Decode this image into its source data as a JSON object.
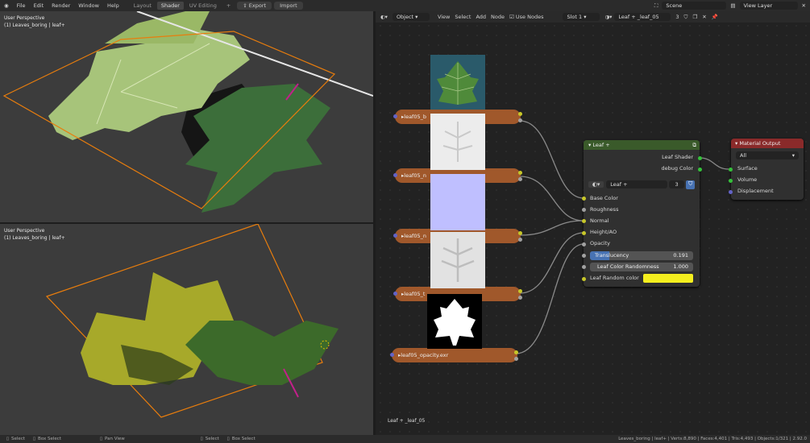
{
  "topbar": {
    "menus": [
      "File",
      "Edit",
      "Render",
      "Window",
      "Help"
    ],
    "workspaces": [
      "Layout",
      "Shader",
      "UV Editing"
    ],
    "active_workspace": "Shader",
    "export_label": "Export",
    "import_label": "Import",
    "scene": "Scene",
    "view_layer": "View Layer"
  },
  "viewport_top": {
    "perspective": "User Perspective",
    "object": "(1) Leaves_boring | leaf+"
  },
  "viewport_bottom": {
    "perspective": "User Perspective",
    "object": "(1) Leaves_boring | leaf+"
  },
  "node_header": {
    "mode": "Object",
    "menus": [
      "View",
      "Select",
      "Add",
      "Node"
    ],
    "use_nodes": "Use Nodes",
    "slot": "Slot 1",
    "material": "Leaf + _leaf_05",
    "users": "3"
  },
  "texture_nodes": [
    {
      "label": "leaf05_b"
    },
    {
      "label": "leaf05_n"
    },
    {
      "label": "leaf05_n"
    },
    {
      "label": "leaf05_t"
    },
    {
      "label": "leaf05_opacity.exr"
    }
  ],
  "leaf_node": {
    "title": "Leaf +",
    "outputs": [
      "Leaf Shader",
      "debug Color"
    ],
    "group_name": "Leaf +",
    "group_users": "3",
    "inputs": [
      "Base Color",
      "Roughness",
      "Normal",
      "Height/AO",
      "Opacity"
    ],
    "translucency_label": "Translucency",
    "translucency_value": "0.191",
    "translucency": 0.191,
    "randomness_label": "Leaf Color Randomness",
    "randomness_value": "1.000",
    "random_color_label": "Leaf Random color",
    "random_color": "#f5ef1e"
  },
  "output_node": {
    "title": "Material Output",
    "target": "All",
    "inputs": [
      "Surface",
      "Volume",
      "Displacement"
    ]
  },
  "material_footer": "Leaf + _leaf_05",
  "statusbar": {
    "items": [
      "Select",
      "Box Select",
      "Pan View",
      "Select",
      "Box Select"
    ],
    "stats": "Leaves_boring | leaf+ | Verts:8,890 | Faces:4,401 | Tris:4,493 | Objects:1/321 | 2.92.0"
  },
  "colors": {
    "accent": "#e87d0d",
    "texture_node": "#a0582b",
    "shader_header": "#3a5a2a",
    "output_header": "#8a2a2a",
    "socket_yellow": "#c7c729",
    "socket_green": "#35c13b",
    "socket_purple": "#6363c7",
    "socket_gray": "#a1a1a1"
  }
}
